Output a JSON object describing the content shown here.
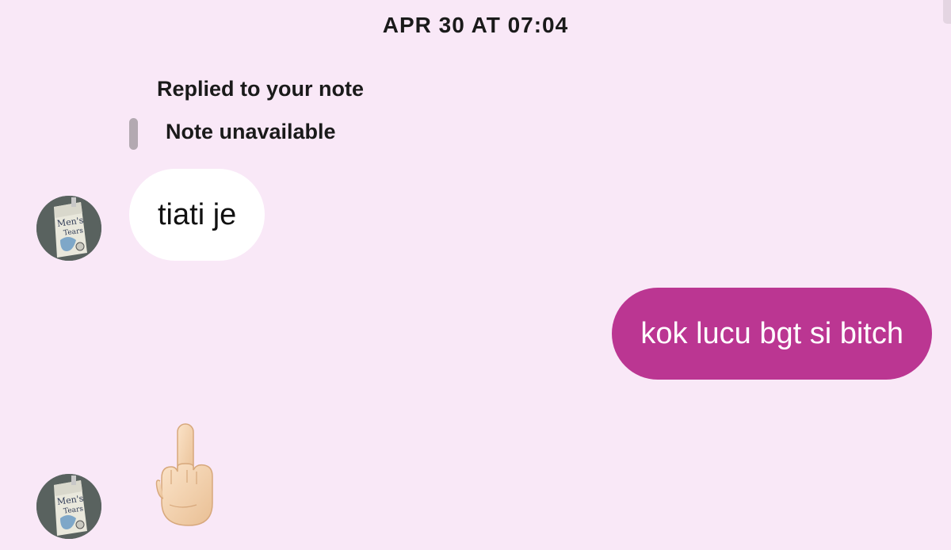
{
  "thread": {
    "timestamp": "APR 30 AT 07:04"
  },
  "reply": {
    "label": "Replied to your note",
    "note_text": "Note unavailable"
  },
  "messages": [
    {
      "sender": "other",
      "text": "tiati je"
    },
    {
      "sender": "me",
      "text": "kok lucu bgt si bitch"
    },
    {
      "sender": "other",
      "emoji": "middle-finger-emoji"
    }
  ],
  "avatar": {
    "line1": "Men's",
    "line2": "Tears"
  },
  "colors": {
    "background": "#f9e8f7",
    "incoming_bubble": "#ffffff",
    "outgoing_bubble": "#bb3692"
  }
}
